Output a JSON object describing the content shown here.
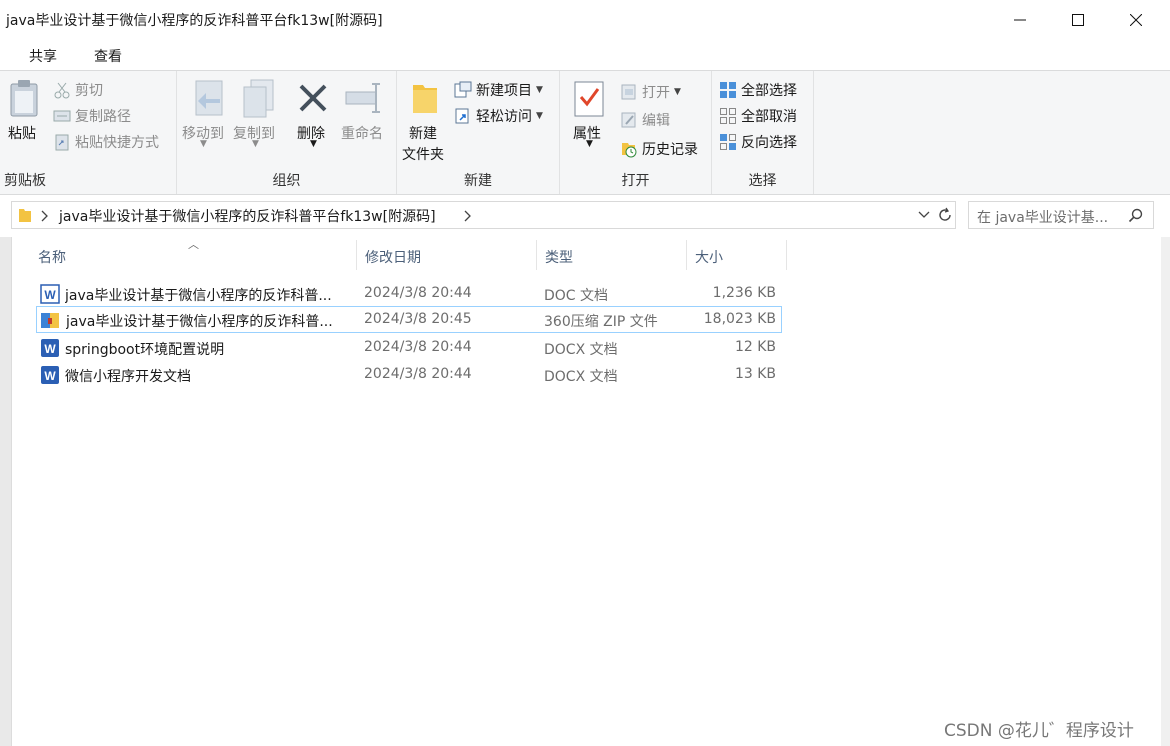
{
  "window": {
    "title": "java毕业设计基于微信小程序的反诈科普平台fk13w[附源码]",
    "minimize_glyph": "—",
    "maximize_glyph": "☐",
    "close_glyph": "✕"
  },
  "ribbon_tabs": {
    "share": "共享",
    "view": "查看",
    "help": "?"
  },
  "ribbon": {
    "clipboard": {
      "paste": "粘贴",
      "cut": "剪切",
      "copy_path": "复制路径",
      "paste_shortcut": "粘贴快捷方式",
      "label": "剪贴板"
    },
    "organize": {
      "move_to": "移动到",
      "copy_to": "复制到",
      "delete": "删除",
      "rename": "重命名",
      "label": "组织"
    },
    "new": {
      "new_folder_line1": "新建",
      "new_folder_line2": "文件夹",
      "new_item": "新建项目",
      "easy_access": "轻松访问",
      "label": "新建"
    },
    "open": {
      "properties": "属性",
      "open": "打开",
      "edit": "编辑",
      "history": "历史记录",
      "label": "打开"
    },
    "select": {
      "select_all": "全部选择",
      "select_none": "全部取消",
      "invert": "反向选择",
      "label": "选择"
    }
  },
  "address": {
    "path": "java毕业设计基于微信小程序的反诈科普平台fk13w[附源码]",
    "search_placeholder": "在 java毕业设计基..."
  },
  "columns": {
    "name": "名称",
    "date": "修改日期",
    "type": "类型",
    "size": "大小"
  },
  "files": [
    {
      "name": "java毕业设计基于微信小程序的反诈科普...",
      "date": "2024/3/8 20:44",
      "type": "DOC 文档",
      "size": "1,236 KB",
      "icon": "word-doc-icon"
    },
    {
      "name": "java毕业设计基于微信小程序的反诈科普...",
      "date": "2024/3/8 20:45",
      "type": "360压缩 ZIP 文件",
      "size": "18,023 KB",
      "icon": "zip-archive-icon"
    },
    {
      "name": "springboot环境配置说明",
      "date": "2024/3/8 20:44",
      "type": "DOCX 文档",
      "size": "12 KB",
      "icon": "word-docx-icon"
    },
    {
      "name": "微信小程序开发文档",
      "date": "2024/3/8 20:44",
      "type": "DOCX 文档",
      "size": "13 KB",
      "icon": "word-docx-icon"
    }
  ],
  "watermark": "CSDN @花儿゛程序设计",
  "colors": {
    "accent": "#1f6fd1",
    "selection_border": "#99d1ff",
    "folder": "#f3c342"
  }
}
